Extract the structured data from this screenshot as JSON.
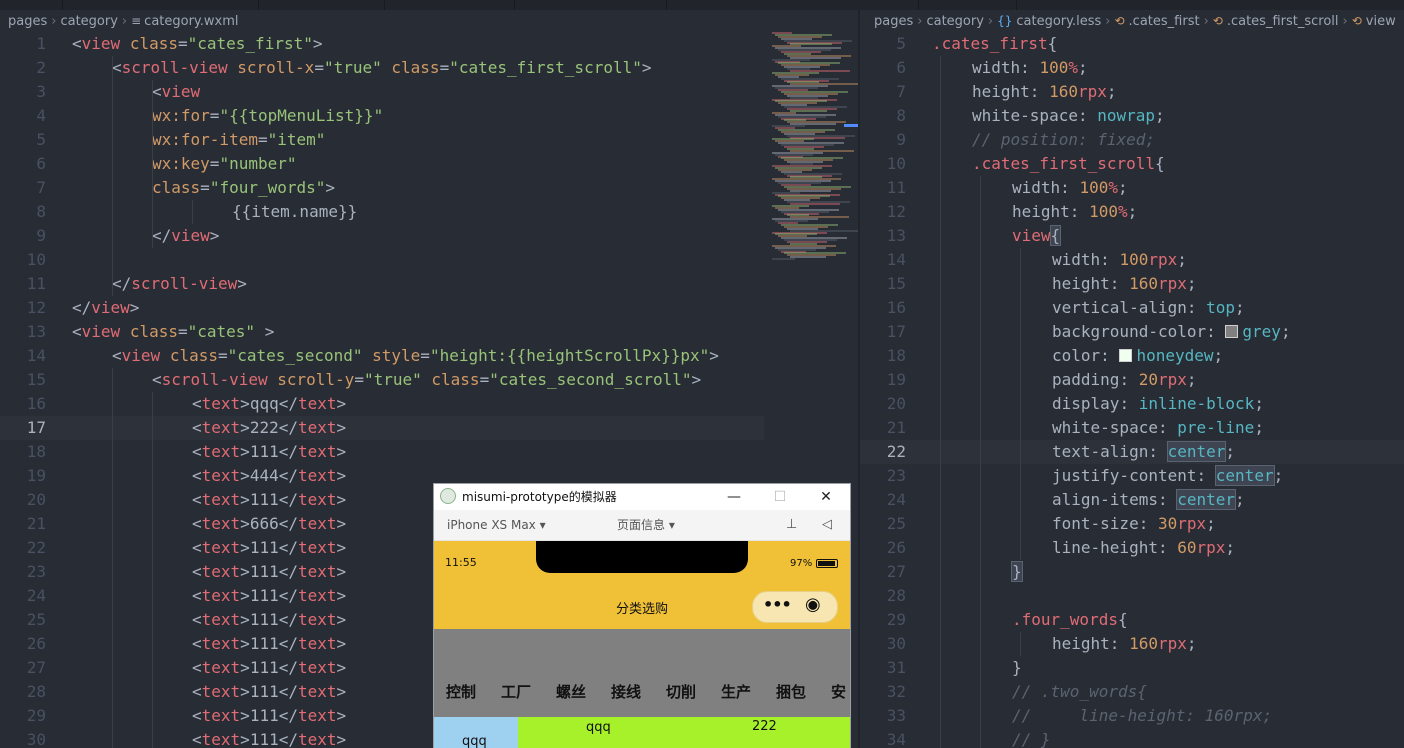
{
  "left_editor": {
    "breadcrumb": [
      "pages",
      "category",
      "category.wxml"
    ],
    "line_numbers": [
      "1",
      "2",
      "3",
      "4",
      "5",
      "6",
      "7",
      "8",
      "9",
      "10",
      "11",
      "12",
      "13",
      "14",
      "15",
      "16",
      "17",
      "18",
      "19",
      "20",
      "21",
      "22",
      "23",
      "24",
      "25",
      "26",
      "27",
      "28",
      "29",
      "30"
    ],
    "code_tokens": {
      "lt": "<",
      "gt": ">",
      "lt_slash": "</",
      "eq": "=",
      "sp": " ",
      "view": "view",
      "scroll_view": "scroll-view",
      "text": "text",
      "class": "class",
      "scroll_x": "scroll-x",
      "scroll_y": "scroll-y",
      "wx_for": "wx:for",
      "wx_for_item": "wx:for-item",
      "wx_key": "wx:key",
      "style": "style",
      "v_cates_first": "\"cates_first\"",
      "v_true": "\"true\"",
      "v_cates_first_scroll": "\"cates_first_scroll\"",
      "v_top_menu": "\"{{topMenuList}}\"",
      "v_item": "\"item\"",
      "v_number": "\"number\"",
      "v_four_words": "\"four_words\"",
      "item_name": "{{item.name}}",
      "v_cates": "\"cates\"",
      "v_cates_second": "\"cates_second\"",
      "v_height_style": "\"height:{{heightScrollPx}}px\"",
      "v_cates_second_scroll": "\"cates_second_scroll\""
    },
    "text_items": [
      "qqq",
      "222",
      "111",
      "444",
      "111",
      "666",
      "111",
      "111",
      "111",
      "111",
      "111",
      "111",
      "111",
      "111",
      "111"
    ]
  },
  "right_editor": {
    "breadcrumb": [
      "pages",
      "category",
      "category.less",
      ".cates_first",
      ".cates_first_scroll",
      "view"
    ],
    "line_numbers": [
      "5",
      "6",
      "7",
      "8",
      "9",
      "10",
      "11",
      "12",
      "13",
      "14",
      "15",
      "16",
      "17",
      "18",
      "19",
      "20",
      "21",
      "22",
      "23",
      "24",
      "25",
      "26",
      "27",
      "28",
      "29",
      "30",
      "31",
      "32",
      "33",
      "34"
    ],
    "css_tokens": {
      "sel_cates_first": ".cates_first",
      "sel_cates_first_scroll": ".cates_first_scroll",
      "sel_view": "view",
      "sel_four_words": ".four_words",
      "lbrace": "{",
      "rbrace": "}",
      "colon": ":",
      "semi": ";",
      "p_width": "width",
      "p_height": "height",
      "p_white_space": "white-space",
      "p_vertical_align": "vertical-align",
      "p_background_color": "background-color",
      "p_color": "color",
      "p_padding": "padding",
      "p_display": "display",
      "p_text_align": "text-align",
      "p_justify_content": "justify-content",
      "p_align_items": "align-items",
      "p_font_size": "font-size",
      "p_line_height": "line-height",
      "n100": "100",
      "n160": "160",
      "n20": "20",
      "n30": "30",
      "n60": "60",
      "u_pct": "%",
      "u_rpx": "rpx",
      "k_nowrap": "nowrap",
      "k_top": "top",
      "k_grey": "grey",
      "k_honeydew": "honeydew",
      "k_inline_block": "inline-block",
      "k_pre_line": "pre-line",
      "k_center": "center",
      "c_position": "// position: fixed;",
      "c_two_words": "// .two_words{",
      "c_line_height": "//     line-height: 160rpx;",
      "c_close": "// }"
    },
    "swatch_colors": {
      "grey": "#808080",
      "honeydew": "#f0fff0"
    }
  },
  "simulator": {
    "window_title": "misumi-prototype的模拟器",
    "device": "iPhone XS Max",
    "page_info": "页面信息",
    "time": "11:55",
    "battery": "97%",
    "nav_title": "分类选购",
    "top_menu": [
      "控制",
      "工厂",
      "螺丝",
      "接线",
      "切削",
      "生产",
      "捆包",
      "安"
    ],
    "left_item": "qqq",
    "second_items": [
      "qqq",
      "222"
    ]
  },
  "icons": {
    "file_lines_icon": "≡",
    "less_braces_icon": "{}",
    "selector_icon": "⟲",
    "minimize_icon": "—",
    "maximize_icon": "☐",
    "close_icon": "✕",
    "pin_icon": "⊥",
    "mute_icon": "◁",
    "dropdown_icon": "▾",
    "capsule_dots_icon": "•••",
    "capsule_target_icon": "◉"
  }
}
